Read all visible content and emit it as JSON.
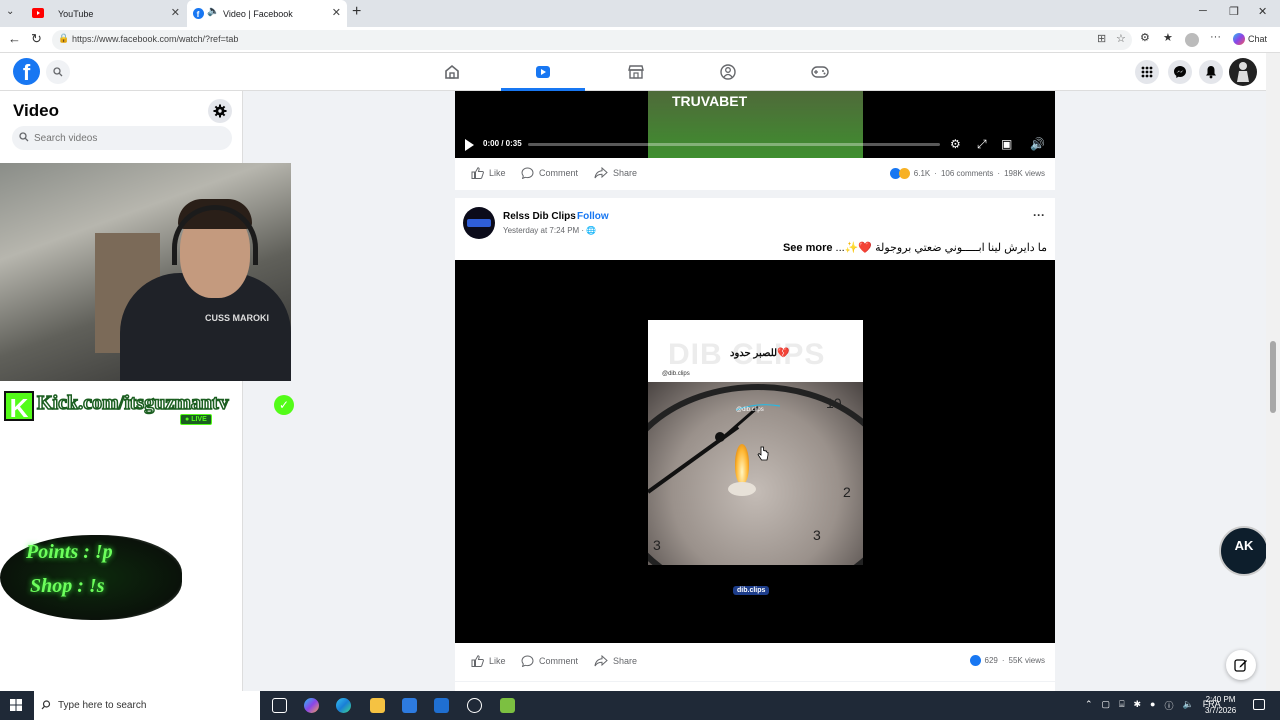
{
  "browser": {
    "tabs": [
      {
        "label": "YouTube",
        "active": false
      },
      {
        "label": "Video | Facebook",
        "active": true
      }
    ],
    "url": "https://www.facebook.com/watch/?ref=tab",
    "chat_label": "Chat"
  },
  "sidebar": {
    "title": "Video",
    "search_placeholder": "Search videos"
  },
  "overlay": {
    "kick_text": "Kick.com/itsguzmantv",
    "live_label": "LIVE",
    "points_text": "Points : !p",
    "shop_text": "Shop : !s",
    "shirt_text": "CUSS MAROKI",
    "ak_text": "AK"
  },
  "post1": {
    "video_banner": "TRUVABET",
    "time": "0:00 / 0:35",
    "actions": {
      "like": "Like",
      "comment": "Comment",
      "share": "Share"
    },
    "reactions": "6.1K",
    "comments": "106 comments",
    "views": "198K views"
  },
  "post2": {
    "author": "Relss Dib Clips",
    "follow": "Follow",
    "separator": "·",
    "time": "Yesterday at 7:24 PM ·",
    "caption": "ما دايرش لينا ابـــــوني ضعتي بروجولة ❤️✨...",
    "see_more": "See more",
    "reel_brand": "DIB CLIPS",
    "reel_arabic": "للصبر حدود💔",
    "reel_handle": "@dib.clips",
    "reel_footer": "dib.clips",
    "actions": {
      "like": "Like",
      "comment": "Comment",
      "share": "Share"
    },
    "reactions": "629",
    "views": "55K views"
  },
  "taskbar": {
    "search_placeholder": "Type here to search",
    "language": "FRA",
    "time": "2:40 PM",
    "date": "3/7/2026"
  },
  "colors": {
    "facebook_blue": "#1877f2",
    "kick_green": "#53fc18"
  }
}
